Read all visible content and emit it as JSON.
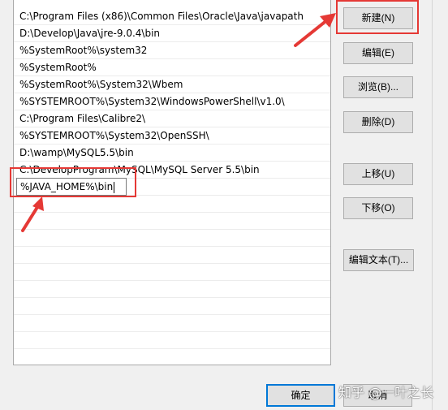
{
  "path_list": {
    "entries": [
      "C:\\Program Files (x86)\\Common Files\\Oracle\\Java\\javapath",
      "D:\\Develop\\Java\\jre-9.0.4\\bin",
      "%SystemRoot%\\system32",
      "%SystemRoot%",
      "%SystemRoot%\\System32\\Wbem",
      "%SYSTEMROOT%\\System32\\WindowsPowerShell\\v1.0\\",
      "C:\\Program Files\\Calibre2\\",
      "%SYSTEMROOT%\\System32\\OpenSSH\\",
      "D:\\wamp\\MySQL5.5\\bin",
      "C:\\DevelopProgram\\MySQL\\MySQL Server 5.5\\bin"
    ],
    "editing_value": "%JAVA_HOME%\\bin"
  },
  "buttons": {
    "new": "新建(N)",
    "edit": "编辑(E)",
    "browse": "浏览(B)...",
    "delete": "删除(D)",
    "move_up": "上移(U)",
    "move_down": "下移(O)",
    "edit_text": "编辑文本(T)...",
    "ok": "确定",
    "cancel": "取消"
  },
  "watermark": "知乎 @一叶之长",
  "colors": {
    "highlight": "#e53935",
    "focus_border": "#0078d7"
  }
}
